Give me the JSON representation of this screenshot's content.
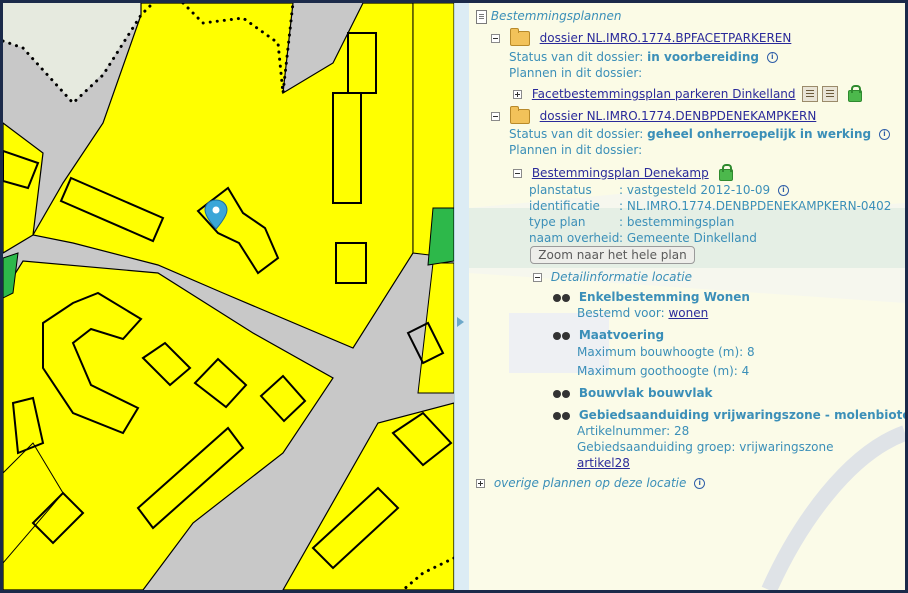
{
  "root": {
    "label": "Bestemmingsplannen"
  },
  "dossiers": [
    {
      "title": "dossier NL.IMRO.1774.BPFACETPARKEREN",
      "status_label": "Status van dit dossier:",
      "status_value": "in voorbereiding",
      "plans_label": "Plannen in dit dossier:",
      "plan_link": "Facetbestemmingsplan parkeren Dinkelland"
    },
    {
      "title": "dossier NL.IMRO.1774.DENBPDENEKAMPKERN",
      "status_label": "Status van dit dossier:",
      "status_value": "geheel onherroepelijk in werking",
      "plans_label": "Plannen in dit dossier:",
      "plan_link": "Bestemmingsplan Denekamp"
    }
  ],
  "plan_details": [
    {
      "key": "planstatus",
      "value": ": vastgesteld 2012-10-09"
    },
    {
      "key": "identificatie",
      "value": ": NL.IMRO.1774.DENBPDENEKAMPKERN-0402"
    },
    {
      "key": "type plan",
      "value": ": bestemmingsplan"
    },
    {
      "key": "naam overheid",
      "value": ": Gemeente Dinkelland"
    }
  ],
  "zoom_button": "Zoom naar het hele plan",
  "detail_section": "Detailinformatie locatie",
  "details": [
    {
      "title": "Enkelbestemming Wonen",
      "lines": [
        "Bestemd voor: "
      ],
      "link": "wonen"
    },
    {
      "title": "Maatvoering",
      "lines": [
        "Maximum bouwhoogte (m): 8",
        "Maximum goothoogte (m): 4"
      ]
    },
    {
      "title": "Bouwvlak bouwvlak",
      "lines": []
    },
    {
      "title": "Gebiedsaanduiding vrijwaringszone - molenbiotoop",
      "lines": [
        "Artikelnummer: 28",
        "Gebiedsaanduiding groep: vrijwaringszone"
      ],
      "link": "artikel28"
    }
  ],
  "other_plans": "overige plannen op deze locatie",
  "colors": {
    "zone_yellow": "#ffff00",
    "road_gray": "#c8c8c8",
    "green": "#2db84a",
    "panel_text": "#3b8fb8",
    "link": "#2a2a9a"
  },
  "icons": [
    "document-icon",
    "folder-icon",
    "info-icon",
    "lock-icon",
    "book-icon",
    "binoculars-icon",
    "map-marker-icon"
  ]
}
